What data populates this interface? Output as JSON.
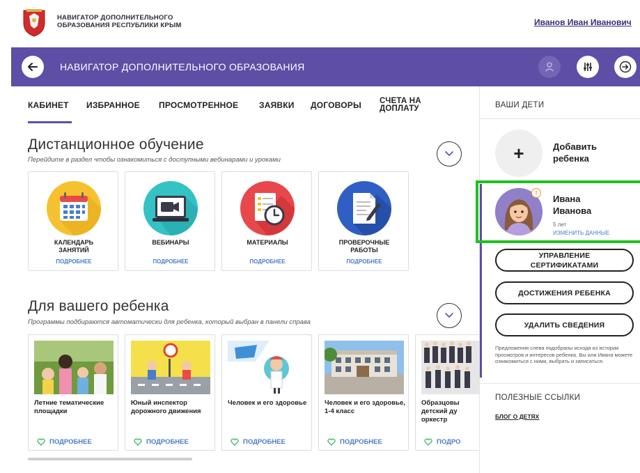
{
  "site": {
    "name_line1": "НАВИГАТОР ДОПОЛНИТЕЛЬНОГО",
    "name_line2": "ОБРАЗОВАНИЯ РЕСПУБЛИКИ КРЫМ",
    "user_name": "Иванов Иван Иванович"
  },
  "bar": {
    "title": "НАВИГАТОР ДОПОЛНИТЕЛЬНОГО ОБРАЗОВАНИЯ",
    "color": "#5e4ea5"
  },
  "tabs": [
    {
      "label": "КАБИНЕТ",
      "active": true
    },
    {
      "label": "ИЗБРАННОЕ"
    },
    {
      "label": "ПРОСМОТРЕННОЕ"
    },
    {
      "label": "ЗАЯВКИ"
    },
    {
      "label": "ДОГОВОРЫ"
    },
    {
      "label_line1": "СЧЕТА НА",
      "label_line2": "ДОПЛАТУ"
    }
  ],
  "distance": {
    "title": "Дистанционное обучение",
    "subtitle": "Перейдите в раздел чтобы ознакомиться с доступными вебинарами и уроками",
    "tiles": [
      {
        "label_line1": "КАЛЕНДАРЬ",
        "label_line2": "ЗАНЯТИЙ",
        "more": "ПОДРОБНЕЕ",
        "icon": "calendar-icon"
      },
      {
        "label_line1": "ВЕБИНАРЫ",
        "label_line2": "",
        "more": "ПОДРОБНЕЕ",
        "icon": "video-camera-icon"
      },
      {
        "label_line1": "МАТЕРИАЛЫ",
        "label_line2": "",
        "more": "ПОДРОБНЕЕ",
        "icon": "document-clock-icon"
      },
      {
        "label_line1": "ПРОВЕРОЧНЫЕ",
        "label_line2": "РАБОТЫ",
        "more": "ПОДРОБНЕЕ",
        "icon": "document-pen-icon"
      }
    ]
  },
  "for_child": {
    "title": "Для вашего ребенка",
    "subtitle": "Программы подбираются автоматически для ребенка, который выбран в панели справа",
    "cards": [
      {
        "title": "Летние тематические площадки",
        "more": "ПОДРОБНЕЕ"
      },
      {
        "title": "Юный инспектор дорожного движения",
        "more": "ПОДРОБНЕЕ"
      },
      {
        "title": "Человек и его здоровье",
        "more": "ПОДРОБНЕЕ"
      },
      {
        "title": "Человек и его здоровье, 1-4 класс",
        "more": "ПОДРОБНЕЕ"
      },
      {
        "title": "Образцовы детский ду оркестр",
        "more": "ПОДРО"
      }
    ]
  },
  "right": {
    "title": "ВАШИ ДЕТИ",
    "add_child_line1": "Добавить",
    "add_child_line2": "ребенка",
    "child": {
      "name_line1": "Ивана",
      "name_line2": "Иванова",
      "age": "5 лет",
      "edit": "ИЗМЕНИТЬ ДАННЫЕ",
      "badge": "!"
    },
    "buttons": {
      "certs_line1": "УПРАВЛЕНИЕ",
      "certs_line2": "СЕРТИФИКАТАМИ",
      "achievements": "ДОСТИЖЕНИЯ РЕБЕНКА",
      "delete": "УДАЛИТЬ СВЕДЕНИЯ"
    },
    "note": "Предложения слева подобраны исходя из истории просмотров и интересов ребенка. Вы или Ивана можете ознакомиться с ними, выбрать и записаться.",
    "links_title": "ПОЛЕЗНЫЕ ССЫЛКИ",
    "link_child": "БЛОГ О ДЕТЯХ"
  }
}
